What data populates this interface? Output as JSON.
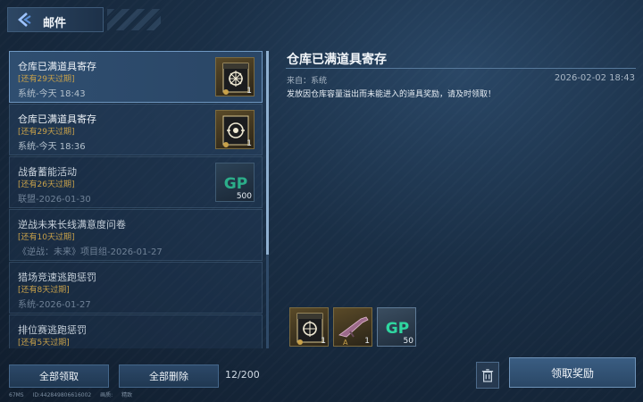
{
  "header": {
    "title": "邮件",
    "back_icon": "back-arrow-icon"
  },
  "mail_list": [
    {
      "title": "仓库已满道具寄存",
      "expiry": "[还有29天过期]",
      "meta": "系统-今天 18:43",
      "state": "selected",
      "thumb": {
        "icon": "crate-gear-icon",
        "count": "1"
      }
    },
    {
      "title": "仓库已满道具寄存",
      "expiry": "[还有29天过期]",
      "meta": "系统-今天 18:36",
      "state": "unread",
      "thumb": {
        "icon": "crate-target-icon",
        "count": "1"
      }
    },
    {
      "title": "战备蓄能活动",
      "expiry": "[还有26天过期]",
      "meta": "联盟-2026-01-30",
      "state": "read",
      "thumb": {
        "icon": "gp-token-icon",
        "count": "500"
      }
    },
    {
      "title": "逆战未来长线满意度问卷",
      "expiry": "[还有10天过期]",
      "meta": "《逆战：未来》项目组-2026-01-27",
      "state": "read"
    },
    {
      "title": "猎场竞速逃跑惩罚",
      "expiry": "[还有8天过期]",
      "meta": "系统-2026-01-27",
      "state": "read"
    },
    {
      "title": "排位赛逃跑惩罚",
      "expiry": "[还有5天过期]",
      "meta": "",
      "state": "read"
    }
  ],
  "list_footer": {
    "claim_all": "全部领取",
    "delete_all": "全部删除",
    "count": "12/200"
  },
  "status_bar": {
    "fps": "67MS",
    "id": "ID:442849806616002",
    "quality_label": "画质:",
    "quality": "精致"
  },
  "detail": {
    "title": "仓库已满道具寄存",
    "from": "来自：系统",
    "date": "2026-02-02 18:43",
    "body": "发放因仓库容量溢出而未能进入的道具奖励，请及时领取！",
    "rewards": [
      {
        "icon": "crate-gear-icon",
        "count": "1"
      },
      {
        "icon": "rifle-icon",
        "count": "1"
      },
      {
        "icon": "gp-token-icon",
        "count": "50"
      }
    ],
    "delete_icon": "trash-icon",
    "claim_button": "领取奖励"
  },
  "colors": {
    "accent_gold": "#c8a14a",
    "gp_green": "#2fd6a0",
    "panel_border": "#6f98c2"
  }
}
